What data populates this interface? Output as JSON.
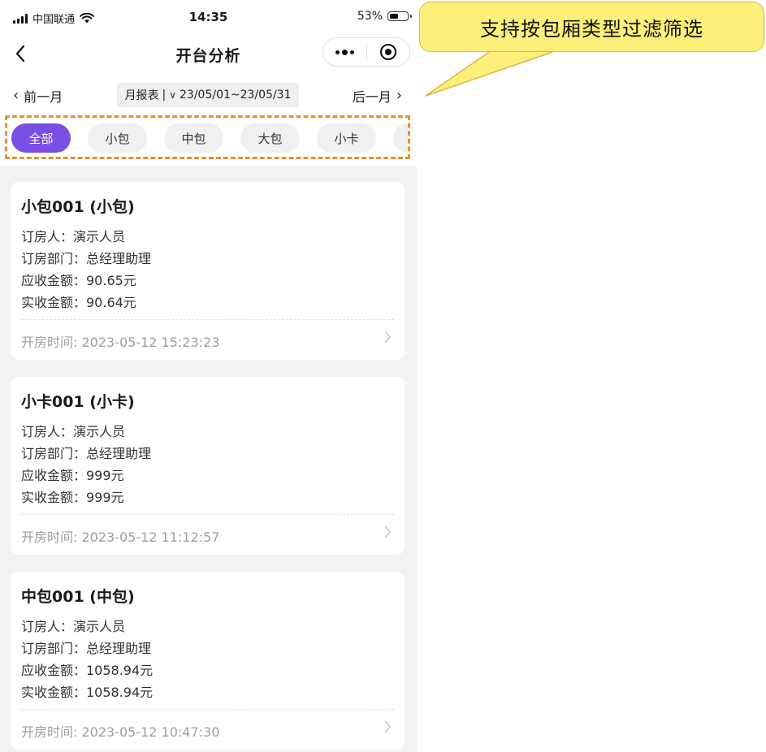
{
  "status_bar": {
    "carrier": "中国联通",
    "time": "14:35",
    "battery": "53%",
    "battery_level": 0.53
  },
  "nav": {
    "title": "开台分析"
  },
  "month_selector": {
    "prev_label": "前一月",
    "next_label": "后一月",
    "period_type": "月报表",
    "separator": "|",
    "caret": "∨",
    "date_range": "23/05/01~23/05/31"
  },
  "filters": {
    "chips": [
      {
        "label": "全部",
        "active": true
      },
      {
        "label": "小包",
        "active": false
      },
      {
        "label": "中包",
        "active": false
      },
      {
        "label": "大包",
        "active": false
      },
      {
        "label": "小卡",
        "active": false
      },
      {
        "label": "",
        "active": false
      }
    ]
  },
  "records": [
    {
      "title": "小包001 (小包)",
      "booker": "订房人：演示人员",
      "department": "订房部门：总经理助理",
      "receivable": "应收金额：90.65元",
      "received": "实收金额：90.64元",
      "open_time": "开房时间: 2023-05-12 15:23:23"
    },
    {
      "title": "小卡001 (小卡)",
      "booker": "订房人：演示人员",
      "department": "订房部门：总经理助理",
      "receivable": "应收金额：999元",
      "received": "实收金额：999元",
      "open_time": "开房时间: 2023-05-12 11:12:57"
    },
    {
      "title": "中包001 (中包)",
      "booker": "订房人：演示人员",
      "department": "订房部门：总经理助理",
      "receivable": "应收金额：1058.94元",
      "received": "实收金额：1058.94元",
      "open_time": "开房时间: 2023-05-12 10:47:30"
    }
  ],
  "callout": {
    "text": "支持按包厢类型过滤筛选"
  },
  "colors": {
    "accent": "#7a4fe3",
    "annotation_border": "#e1932c",
    "callout_fill": "#fdf07a"
  }
}
